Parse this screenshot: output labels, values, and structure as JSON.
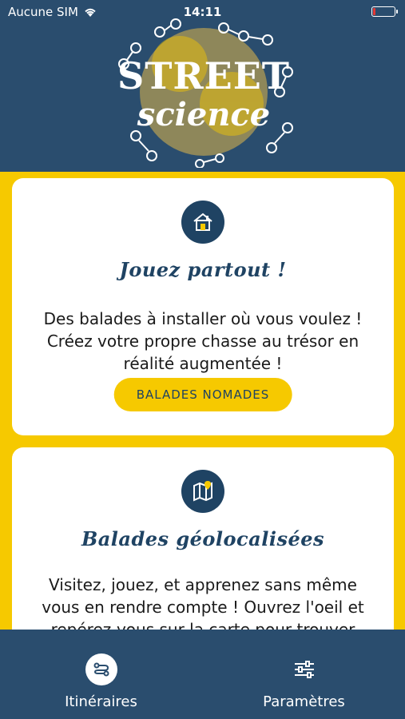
{
  "status_bar": {
    "carrier": "Aucune SIM",
    "time": "14:11",
    "battery_level": 0.1,
    "battery_color": "#e53935"
  },
  "logo": {
    "line1": "STREET",
    "line2": "science"
  },
  "cards": [
    {
      "title": "Jouez partout !",
      "text": "Des balades à installer où vous voulez ! Créez votre propre chasse au trésor en réalité augmentée !",
      "button": "BALADES NOMADES",
      "icon": "house-icon"
    },
    {
      "title": "Balades géolocalisées",
      "text": "Visitez, jouez, et apprenez sans même vous en rendre compte ! Ouvrez l'oeil et repérez-vous sur la carte pour trouver",
      "icon": "map-pin-icon"
    }
  ],
  "tabs": [
    {
      "label": "Itinéraires",
      "icon": "route-icon",
      "active": true
    },
    {
      "label": "Paramètres",
      "icon": "sliders-icon",
      "active": false
    }
  ],
  "colors": {
    "navy": "#2a4d6e",
    "yellow": "#f6c900",
    "dark_navy": "#1f4363"
  }
}
